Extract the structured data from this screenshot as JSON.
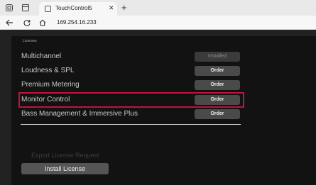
{
  "browser": {
    "tab_title": "TouchControl5",
    "url": "169.254.16.233",
    "new_tab_glyph": "+",
    "close_glyph": "✕"
  },
  "licenses": {
    "title": "Licenses",
    "rows": [
      {
        "name": "Multichannel",
        "button": "Installed",
        "state": "disabled"
      },
      {
        "name": "Loudness & SPL",
        "button": "Order",
        "state": "enabled"
      },
      {
        "name": "Premium Metering",
        "button": "Order",
        "state": "enabled"
      },
      {
        "name": "Monitor Control",
        "button": "Order",
        "state": "enabled",
        "highlighted": true
      },
      {
        "name": "Bass Management & Immersive Plus",
        "button": "Order",
        "state": "enabled"
      }
    ],
    "export_label": "Export License Request",
    "install_label": "Install License"
  },
  "colors": {
    "highlight": "#c0123c",
    "panel": "#121212",
    "button": "#4a4a4a"
  }
}
